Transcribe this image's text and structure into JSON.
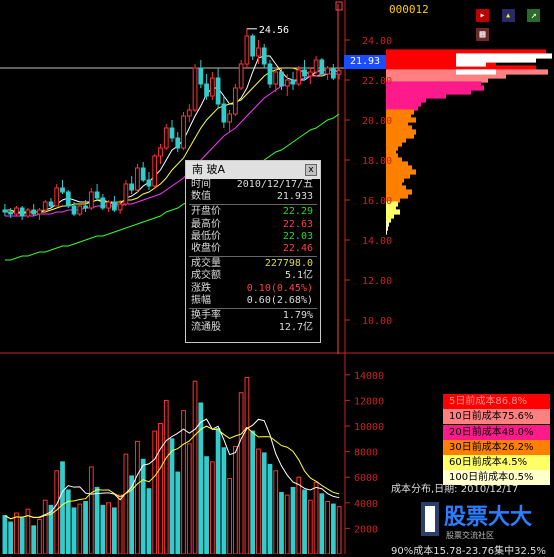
{
  "symbol": "000012",
  "price_line_label": "21.93",
  "peak_label": "24.56",
  "price_axis_ticks": [
    "24.00",
    "22.00",
    "20.00",
    "18.00",
    "16.00",
    "14.00",
    "12.00",
    "10.00"
  ],
  "volume_axis_ticks": [
    "14000",
    "12000",
    "10000",
    "8000",
    "6000",
    "4000",
    "2000"
  ],
  "data_window": {
    "title": "南 玻A",
    "close_glyph": "x",
    "rows": [
      {
        "label": "时间",
        "value": "2010/12/17/五",
        "color": "#dddddd"
      },
      {
        "label": "数值",
        "value": "21.933",
        "color": "#dddddd"
      },
      {
        "label": "开盘价",
        "value": "22.29",
        "color": "#22dd22"
      },
      {
        "label": "最高价",
        "value": "22.63",
        "color": "#ff4040"
      },
      {
        "label": "最低价",
        "value": "22.03",
        "color": "#22dd22"
      },
      {
        "label": "收盘价",
        "value": "22.46",
        "color": "#ff4040"
      },
      {
        "label": "成交量",
        "value": "227798.0",
        "color": "#dddd33"
      },
      {
        "label": "成交额",
        "value": "5.1亿",
        "color": "#dddddd"
      },
      {
        "label": "涨跌",
        "value": "0.10(0.45%)",
        "color": "#ff4040"
      },
      {
        "label": "振幅",
        "value": "0.60(2.68%)",
        "color": "#dddddd"
      },
      {
        "label": "换手率",
        "value": "1.79%",
        "color": "#dddddd"
      },
      {
        "label": "流通股",
        "value": "12.7亿",
        "color": "#dddddd"
      }
    ]
  },
  "cost_legend": [
    {
      "text": "5日前成本86.8%",
      "bg": "#ff0000",
      "color": "#ff9090"
    },
    {
      "text": "10日前成本75.6%",
      "bg": "#ff8080",
      "color": "#000000"
    },
    {
      "text": "20日前成本48.0%",
      "bg": "#ff1a8c",
      "color": "#000000"
    },
    {
      "text": "30日前成本26.2%",
      "bg": "#ff8000",
      "color": "#000000"
    },
    {
      "text": "60日前成本4.5%",
      "bg": "#ffff66",
      "color": "#000000"
    },
    {
      "text": "100日前成本0.5%",
      "bg": "#ffffcc",
      "color": "#000000"
    }
  ],
  "cost_info": {
    "line1": "成本分布,日期: 2010/12/17",
    "line2": "90%成本15.78-23.76集中32.5%"
  },
  "logo_text": "股票大大",
  "logo_sub": "股票交流社区",
  "icons": [
    "flag-icon",
    "fill-icon",
    "chart-icon",
    "grid-icon"
  ],
  "colors": {
    "up": "#ff3333",
    "down": "#33cccc",
    "ma5": "#ffffff",
    "ma10": "#ffff33",
    "ma20": "#ff33ff",
    "ma60": "#33ff33",
    "grid": "#8a1a1a",
    "axis": "#cc2222"
  },
  "chart_data": {
    "type": "candlestick",
    "y_range": [
      8.5,
      25.5
    ],
    "volume_range": [
      0,
      15000
    ],
    "candles": [
      [
        15.5,
        15.8,
        15.2,
        15.4
      ],
      [
        15.4,
        15.6,
        15.1,
        15.3
      ],
      [
        15.3,
        15.7,
        15.2,
        15.6
      ],
      [
        15.6,
        15.7,
        15.0,
        15.2
      ],
      [
        15.2,
        15.6,
        15.1,
        15.5
      ],
      [
        15.5,
        15.8,
        15.2,
        15.3
      ],
      [
        15.3,
        15.6,
        15.0,
        15.5
      ],
      [
        15.5,
        16.0,
        15.4,
        15.9
      ],
      [
        15.9,
        16.1,
        15.6,
        15.7
      ],
      [
        15.7,
        16.8,
        15.7,
        16.6
      ],
      [
        16.6,
        17.0,
        16.3,
        16.4
      ],
      [
        16.4,
        16.5,
        15.6,
        15.7
      ],
      [
        15.7,
        15.9,
        15.2,
        15.3
      ],
      [
        15.3,
        15.8,
        15.2,
        15.7
      ],
      [
        15.7,
        16.0,
        15.4,
        15.6
      ],
      [
        15.6,
        16.6,
        15.5,
        16.4
      ],
      [
        16.4,
        16.8,
        16.0,
        16.1
      ],
      [
        16.1,
        16.3,
        15.5,
        15.6
      ],
      [
        15.6,
        16.0,
        15.4,
        15.9
      ],
      [
        15.9,
        16.2,
        15.4,
        15.5
      ],
      [
        15.5,
        16.0,
        15.3,
        15.8
      ],
      [
        15.8,
        17.0,
        15.7,
        16.8
      ],
      [
        16.8,
        17.2,
        16.3,
        16.5
      ],
      [
        16.5,
        17.8,
        16.4,
        17.6
      ],
      [
        17.6,
        17.9,
        16.9,
        17.0
      ],
      [
        17.0,
        17.4,
        16.5,
        16.7
      ],
      [
        16.7,
        18.3,
        16.6,
        18.2
      ],
      [
        18.2,
        18.8,
        17.8,
        18.6
      ],
      [
        18.6,
        19.8,
        18.5,
        19.6
      ],
      [
        19.6,
        20.0,
        18.9,
        19.1
      ],
      [
        19.1,
        19.4,
        18.4,
        18.6
      ],
      [
        18.6,
        20.4,
        18.5,
        20.2
      ],
      [
        20.2,
        20.8,
        19.9,
        20.5
      ],
      [
        20.5,
        22.8,
        20.4,
        22.6
      ],
      [
        22.6,
        23.0,
        21.6,
        21.8
      ],
      [
        21.8,
        22.3,
        21.0,
        21.2
      ],
      [
        21.2,
        22.4,
        21.0,
        22.1
      ],
      [
        22.1,
        22.6,
        20.6,
        20.8
      ],
      [
        20.8,
        21.2,
        19.6,
        19.9
      ],
      [
        19.9,
        20.5,
        19.4,
        20.3
      ],
      [
        20.3,
        21.8,
        20.2,
        21.6
      ],
      [
        21.6,
        23.0,
        21.5,
        22.8
      ],
      [
        22.8,
        24.56,
        22.6,
        24.2
      ],
      [
        24.2,
        24.3,
        23.0,
        23.2
      ],
      [
        23.2,
        24.0,
        22.8,
        23.6
      ],
      [
        23.6,
        23.8,
        22.6,
        22.8
      ],
      [
        22.8,
        23.0,
        21.6,
        21.8
      ],
      [
        21.8,
        22.6,
        21.4,
        22.4
      ],
      [
        22.4,
        22.6,
        21.5,
        21.7
      ],
      [
        21.7,
        22.3,
        21.2,
        22.0
      ],
      [
        22.0,
        22.4,
        21.5,
        21.8
      ],
      [
        21.8,
        22.7,
        21.7,
        22.5
      ],
      [
        22.5,
        23.0,
        22.0,
        22.2
      ],
      [
        22.2,
        22.6,
        21.8,
        22.4
      ],
      [
        22.4,
        23.2,
        22.3,
        23.0
      ],
      [
        23.0,
        23.1,
        22.2,
        22.3
      ],
      [
        22.3,
        22.7,
        22.0,
        22.6
      ],
      [
        22.6,
        22.8,
        22.0,
        22.1
      ],
      [
        22.29,
        22.63,
        22.03,
        22.46
      ]
    ],
    "volumes": [
      3000,
      2500,
      3200,
      2800,
      3500,
      2200,
      2700,
      4200,
      3800,
      6500,
      7200,
      5000,
      3600,
      3900,
      4100,
      6800,
      5200,
      3800,
      4000,
      3600,
      4600,
      7800,
      6100,
      8800,
      7400,
      5100,
      9600,
      10200,
      12000,
      9000,
      6400,
      11200,
      8600,
      13500,
      11800,
      7600,
      7200,
      9800,
      8300,
      5900,
      8400,
      12600,
      13800,
      9600,
      8200,
      7900,
      7000,
      6500,
      4800,
      4600,
      5200,
      6000,
      5000,
      4200,
      5600,
      4700,
      4100,
      3900,
      3700
    ],
    "ma5": [
      15.4,
      15.4,
      15.4,
      15.3,
      15.4,
      15.4,
      15.4,
      15.5,
      15.6,
      15.8,
      16.0,
      16.1,
      16.0,
      15.9,
      15.9,
      15.9,
      16.0,
      15.9,
      15.9,
      15.8,
      15.8,
      16.1,
      16.2,
      16.4,
      16.7,
      16.9,
      17.2,
      17.5,
      18.0,
      18.5,
      18.7,
      19.0,
      19.6,
      20.2,
      20.7,
      21.3,
      21.6,
      21.6,
      21.2,
      20.8,
      20.8,
      21.1,
      21.6,
      22.4,
      23.1,
      23.2,
      23.2,
      22.8,
      22.4,
      22.1,
      22.0,
      22.0,
      22.0,
      22.2,
      22.4,
      22.5,
      22.5,
      22.5,
      22.4
    ],
    "ma10": [
      15.5,
      15.5,
      15.4,
      15.4,
      15.4,
      15.4,
      15.4,
      15.4,
      15.5,
      15.6,
      15.7,
      15.7,
      15.8,
      15.8,
      15.8,
      15.9,
      16.0,
      16.0,
      15.9,
      15.9,
      15.9,
      16.0,
      16.0,
      16.1,
      16.3,
      16.4,
      16.6,
      16.8,
      17.1,
      17.5,
      17.8,
      18.1,
      18.6,
      19.1,
      19.6,
      20.0,
      20.3,
      20.6,
      20.7,
      20.8,
      20.9,
      21.0,
      21.3,
      21.6,
      21.9,
      22.2,
      22.4,
      22.5,
      22.6,
      22.6,
      22.6,
      22.5,
      22.4,
      22.3,
      22.2,
      22.2,
      22.3,
      22.3,
      22.3
    ],
    "ma20": [
      15.2,
      15.2,
      15.2,
      15.2,
      15.2,
      15.2,
      15.3,
      15.3,
      15.3,
      15.4,
      15.4,
      15.5,
      15.5,
      15.5,
      15.6,
      15.6,
      15.7,
      15.7,
      15.7,
      15.7,
      15.7,
      15.8,
      15.8,
      15.9,
      16.0,
      16.1,
      16.2,
      16.3,
      16.5,
      16.7,
      16.9,
      17.1,
      17.4,
      17.7,
      18.0,
      18.3,
      18.6,
      18.9,
      19.2,
      19.4,
      19.6,
      19.9,
      20.2,
      20.5,
      20.8,
      21.1,
      21.3,
      21.5,
      21.7,
      21.8,
      21.9,
      22.0,
      22.1,
      22.2,
      22.2,
      22.3,
      22.3,
      22.3,
      22.3
    ],
    "ma60": [
      13.0,
      13.0,
      13.1,
      13.2,
      13.2,
      13.3,
      13.4,
      13.4,
      13.5,
      13.6,
      13.7,
      13.7,
      13.8,
      13.9,
      14.0,
      14.1,
      14.2,
      14.2,
      14.3,
      14.4,
      14.5,
      14.6,
      14.7,
      14.8,
      14.9,
      15.0,
      15.1,
      15.2,
      15.4,
      15.5,
      15.6,
      15.8,
      15.9,
      16.1,
      16.2,
      16.4,
      16.5,
      16.7,
      16.8,
      17.0,
      17.1,
      17.3,
      17.5,
      17.6,
      17.8,
      18.0,
      18.2,
      18.4,
      18.5,
      18.7,
      18.9,
      19.1,
      19.3,
      19.5,
      19.6,
      19.8,
      20.0,
      20.1,
      20.3
    ],
    "distribution": [
      {
        "price": 23.4,
        "w": 160
      },
      {
        "price": 23.2,
        "w": 140
      },
      {
        "price": 23.0,
        "w": 128
      },
      {
        "price": 22.8,
        "w": 110
      },
      {
        "price": 22.6,
        "w": 150
      },
      {
        "price": 22.4,
        "w": 162
      },
      {
        "price": 22.2,
        "w": 120
      },
      {
        "price": 22.0,
        "w": 102
      },
      {
        "price": 21.8,
        "w": 95
      },
      {
        "price": 21.6,
        "w": 98
      },
      {
        "price": 21.4,
        "w": 85
      },
      {
        "price": 21.2,
        "w": 60
      },
      {
        "price": 21.0,
        "w": 40
      },
      {
        "price": 20.8,
        "w": 35
      },
      {
        "price": 20.6,
        "w": 32
      },
      {
        "price": 20.4,
        "w": 28
      },
      {
        "price": 20.2,
        "w": 25
      },
      {
        "price": 20.0,
        "w": 30
      },
      {
        "price": 19.8,
        "w": 22
      },
      {
        "price": 19.6,
        "w": 26
      },
      {
        "price": 19.4,
        "w": 30
      },
      {
        "price": 19.2,
        "w": 28
      },
      {
        "price": 19.0,
        "w": 20
      },
      {
        "price": 18.8,
        "w": 16
      },
      {
        "price": 18.6,
        "w": 12
      },
      {
        "price": 18.4,
        "w": 10
      },
      {
        "price": 18.2,
        "w": 12
      },
      {
        "price": 18.0,
        "w": 16
      },
      {
        "price": 17.8,
        "w": 22
      },
      {
        "price": 17.6,
        "w": 26
      },
      {
        "price": 17.4,
        "w": 30
      },
      {
        "price": 17.2,
        "w": 24
      },
      {
        "price": 17.0,
        "w": 18
      },
      {
        "price": 16.8,
        "w": 16
      },
      {
        "price": 16.6,
        "w": 20
      },
      {
        "price": 16.4,
        "w": 26
      },
      {
        "price": 16.2,
        "w": 22
      },
      {
        "price": 16.0,
        "w": 14
      },
      {
        "price": 15.8,
        "w": 12
      },
      {
        "price": 15.6,
        "w": 10
      },
      {
        "price": 15.4,
        "w": 14
      },
      {
        "price": 15.2,
        "w": 8
      },
      {
        "price": 15.0,
        "w": 5
      },
      {
        "price": 14.8,
        "w": 3
      },
      {
        "price": 14.6,
        "w": 2
      },
      {
        "price": 14.4,
        "w": 1
      }
    ]
  }
}
